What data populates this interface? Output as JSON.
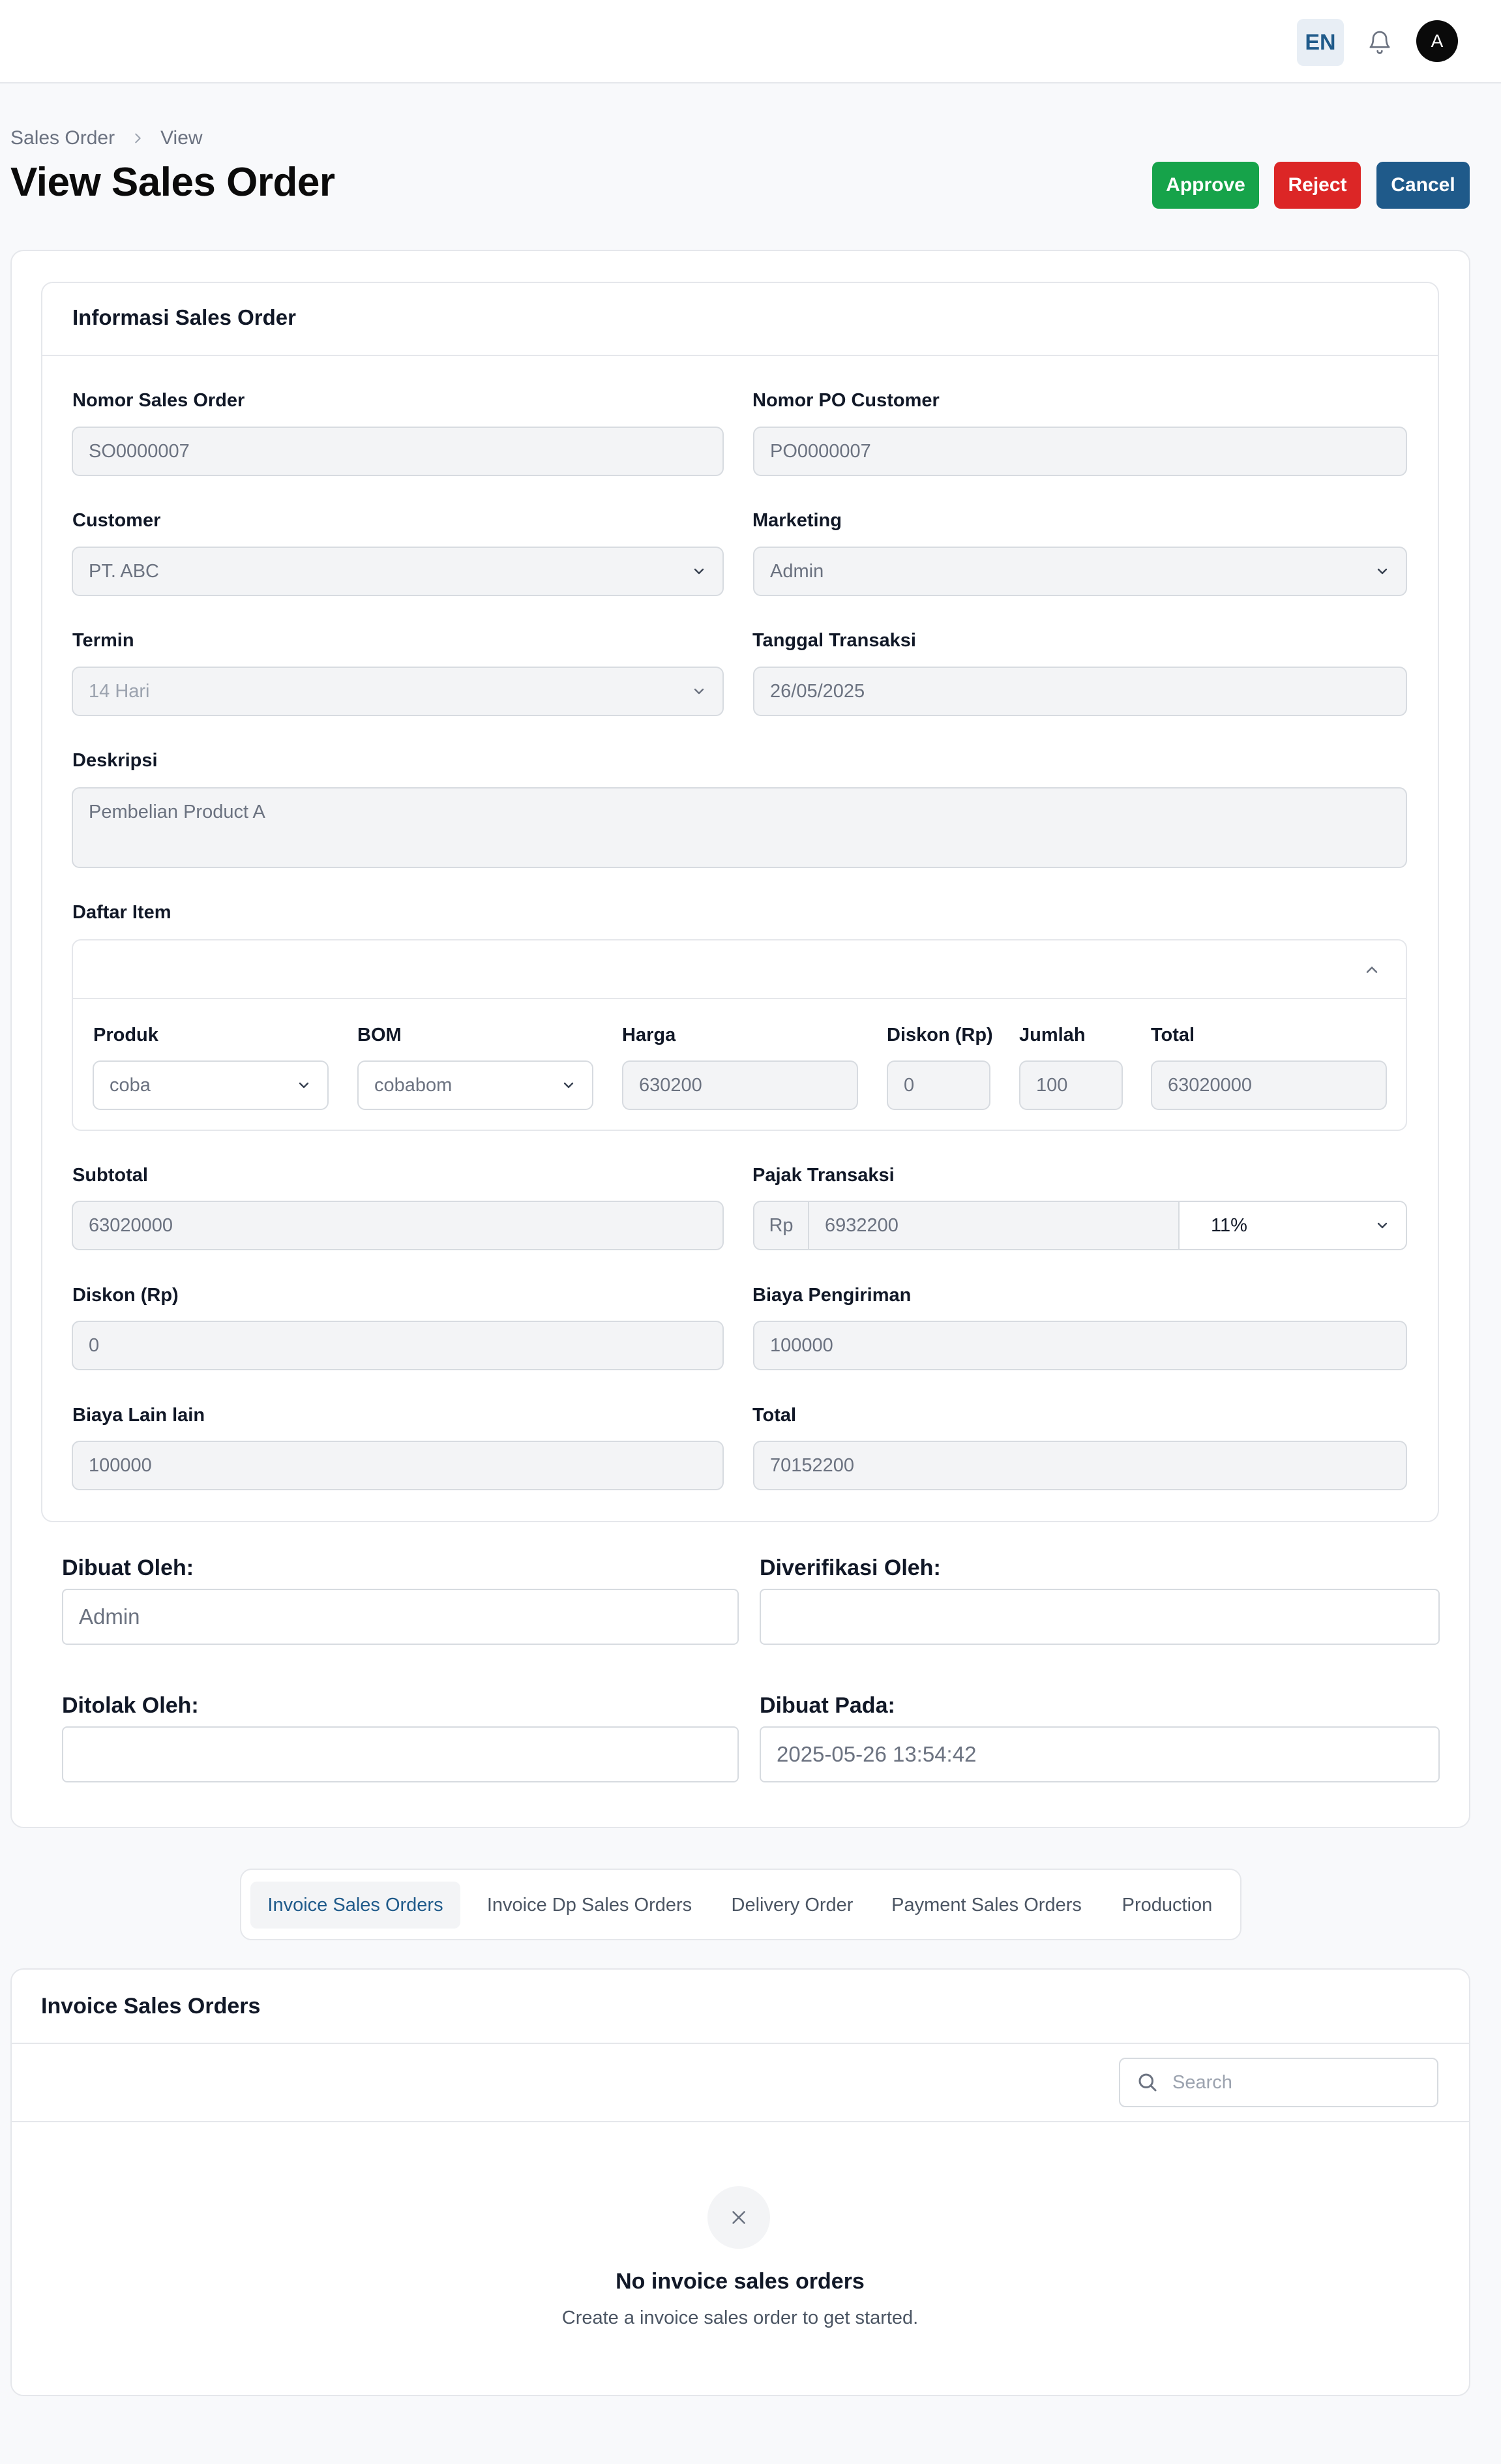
{
  "header": {
    "language": "EN",
    "avatar_initial": "A"
  },
  "breadcrumb": {
    "parent": "Sales Order",
    "current": "View"
  },
  "page": {
    "title": "View Sales Order"
  },
  "actions": {
    "approve": "Approve",
    "reject": "Reject",
    "cancel": "Cancel"
  },
  "form": {
    "section_title": "Informasi Sales Order",
    "nomor_so": {
      "label": "Nomor Sales Order",
      "value": "SO0000007"
    },
    "nomor_po": {
      "label": "Nomor PO Customer",
      "value": "PO0000007"
    },
    "customer": {
      "label": "Customer",
      "value": "PT. ABC"
    },
    "marketing": {
      "label": "Marketing",
      "value": "Admin"
    },
    "termin": {
      "label": "Termin",
      "value": "14 Hari"
    },
    "tanggal": {
      "label": "Tanggal Transaksi",
      "value": "26/05/2025"
    },
    "deskripsi": {
      "label": "Deskripsi",
      "value": "Pembelian Product A"
    },
    "daftar_item_label": "Daftar Item",
    "item_columns": {
      "produk": "Produk",
      "bom": "BOM",
      "harga": "Harga",
      "diskon": "Diskon (Rp)",
      "jumlah": "Jumlah",
      "total": "Total"
    },
    "items": [
      {
        "produk": "coba",
        "bom": "cobabom",
        "harga": "630200",
        "diskon": "0",
        "jumlah": "100",
        "total": "63020000"
      }
    ],
    "subtotal": {
      "label": "Subtotal",
      "value": "63020000"
    },
    "pajak": {
      "label": "Pajak Transaksi",
      "prefix": "Rp",
      "value": "6932200",
      "rate": "11%"
    },
    "diskon": {
      "label": "Diskon (Rp)",
      "value": "0"
    },
    "biaya_pengiriman": {
      "label": "Biaya Pengiriman",
      "value": "100000"
    },
    "biaya_lain": {
      "label": "Biaya Lain lain",
      "value": "100000"
    },
    "total": {
      "label": "Total",
      "value": "70152200"
    }
  },
  "meta": {
    "dibuat_oleh": {
      "label": "Dibuat Oleh:",
      "value": "Admin"
    },
    "diverifikasi_oleh": {
      "label": "Diverifikasi Oleh:",
      "value": ""
    },
    "ditolak_oleh": {
      "label": "Ditolak Oleh:",
      "value": ""
    },
    "dibuat_pada": {
      "label": "Dibuat Pada:",
      "value": "2025-05-26 13:54:42"
    }
  },
  "tabs": [
    {
      "label": "Invoice Sales Orders",
      "active": true
    },
    {
      "label": "Invoice Dp Sales Orders",
      "active": false
    },
    {
      "label": "Delivery Order",
      "active": false
    },
    {
      "label": "Payment Sales Orders",
      "active": false
    },
    {
      "label": "Production",
      "active": false
    }
  ],
  "invoice_section": {
    "title": "Invoice Sales Orders",
    "search_placeholder": "Search",
    "empty_title": "No invoice sales orders",
    "empty_subtitle": "Create a invoice sales order to get started."
  },
  "colors": {
    "approve": "#16a34a",
    "reject": "#dc2626",
    "primary": "#1f5a8a"
  }
}
